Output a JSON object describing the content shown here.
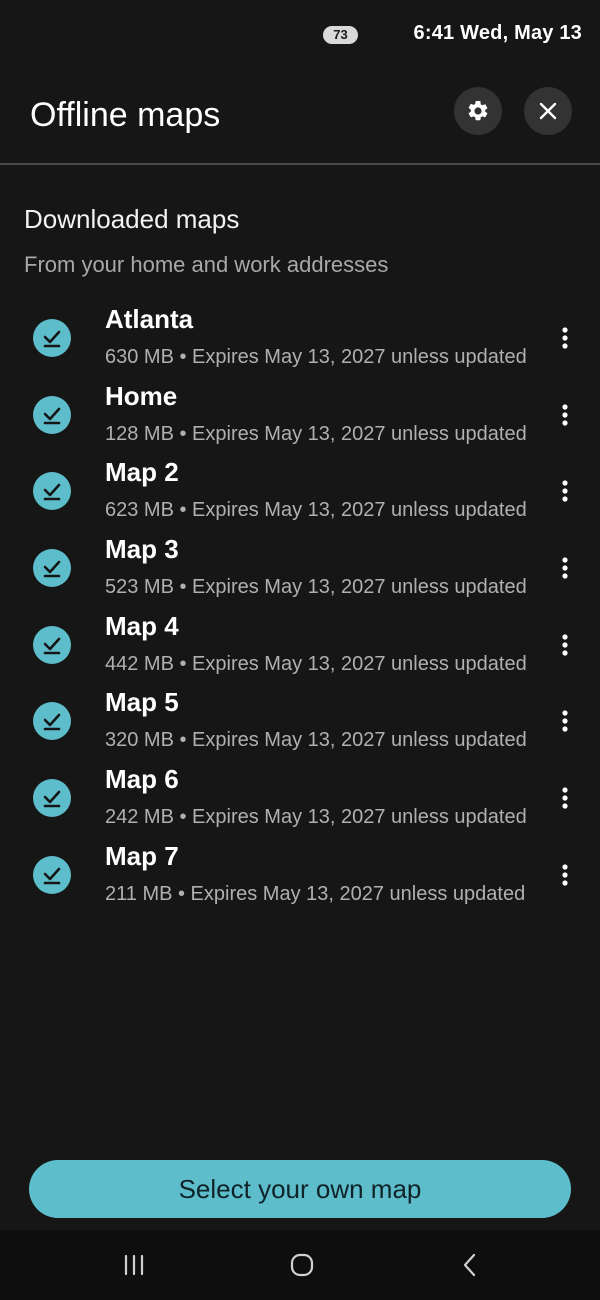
{
  "status_bar": {
    "battery": "73",
    "time_date": "6:41  Wed, May 13"
  },
  "header": {
    "title": "Offline maps",
    "settings_icon": "gear-icon",
    "close_icon": "close-icon"
  },
  "section": {
    "title": "Downloaded maps",
    "subtitle": "From your home and work addresses"
  },
  "maps": [
    {
      "name": "Atlanta",
      "meta": "630 MB • Expires May 13, 2027 unless updated"
    },
    {
      "name": "Home",
      "meta": "128 MB • Expires May 13, 2027 unless updated"
    },
    {
      "name": "Map 2",
      "meta": "623 MB • Expires May 13, 2027 unless updated"
    },
    {
      "name": "Map 3",
      "meta": "523 MB • Expires May 13, 2027 unless updated"
    },
    {
      "name": "Map 4",
      "meta": "442 MB • Expires May 13, 2027 unless updated"
    },
    {
      "name": "Map 5",
      "meta": "320 MB • Expires May 13, 2027 unless updated"
    },
    {
      "name": "Map 6",
      "meta": "242 MB • Expires May 13, 2027 unless updated"
    },
    {
      "name": "Map 7",
      "meta": "211 MB • Expires May 13, 2027 unless updated"
    }
  ],
  "primary_action": {
    "label": "Select your own map"
  },
  "colors": {
    "accent": "#5dbdcb",
    "background": "#161616"
  },
  "nav_bar": {
    "recents_icon": "recents-icon",
    "home_icon": "home-icon",
    "back_icon": "back-icon"
  }
}
